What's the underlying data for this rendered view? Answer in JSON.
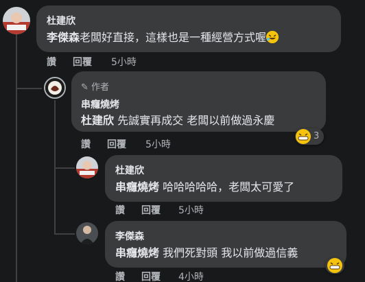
{
  "comments": [
    {
      "author": "杜建欣",
      "mention": "李傑森",
      "body": "老闆好直接，這樣也是一種經營方式喔",
      "actions": {
        "like": "讚",
        "reply": "回覆",
        "time": "5小時"
      }
    },
    {
      "author_badge": "作者",
      "author": "串癮燒烤",
      "mention": "杜建欣",
      "body": " 先誠實再成交 老闆以前做過永慶",
      "reaction_count": "3",
      "actions": {
        "like": "讚",
        "reply": "回覆",
        "time": "5小時"
      }
    },
    {
      "author": "杜建欣",
      "mention": "串癮燒烤",
      "body": " 哈哈哈哈哈，老闆太可愛了",
      "actions": {
        "like": "讚",
        "reply": "回覆",
        "time": "5小時"
      }
    },
    {
      "author": "李傑森",
      "mention": "串癮燒烤",
      "body": " 我們死對頭 我以前做過信義",
      "actions": {
        "like": "讚",
        "reply": "回覆",
        "time": "4小時"
      }
    }
  ],
  "colors": {
    "background": "#18191a",
    "bubble": "#3a3b3c",
    "text": "#e4e6eb",
    "muted": "#b0b3b8",
    "emoji": "#f5c20c"
  },
  "icons": {
    "author_badge": "pencil-icon",
    "emoji_laugh": "rolling-laughing-emoji",
    "emoji_grin": "grinning-sweat-emoji"
  }
}
